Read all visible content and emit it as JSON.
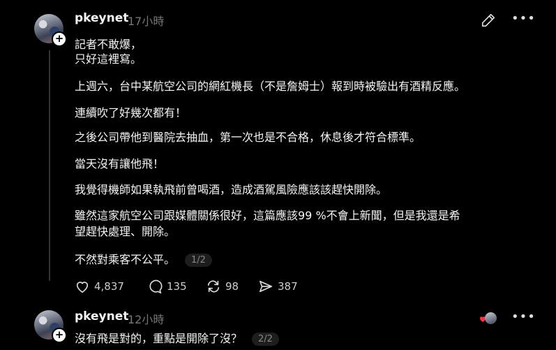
{
  "post1": {
    "username": "pkeynet",
    "time": "17小時",
    "lines": [
      "記者不敢爆，",
      "只好這裡寫。",
      "上週六，台中某航空公司的網紅機長（不是詹姆士）報到時被驗出有酒精反應。",
      "連續吹了好幾次都有！",
      "之後公司帶他到醫院去抽血，第一次也是不合格，休息後才符合標準。",
      "當天沒有讓他飛！",
      "我覺得機師如果執飛前曾喝酒，造成酒駕風險應該該趕快開除。",
      "￼雖然這家航空公司跟媒體關係很好，這篇應該99 %不會上新聞，但是我還是希",
      "望趕快處理、開除。",
      "￼不然對乘客不公平。"
    ],
    "page": "1/2",
    "likes": "4,837",
    "comments": "135",
    "reposts": "98",
    "shares": "387"
  },
  "post2": {
    "username": "pkeynet",
    "time": "12小時",
    "text": "沒有飛是對的，重點是開除了沒？",
    "page": "2/2"
  },
  "icons": {
    "edit": "pencil-icon",
    "more": "more-dots-icon",
    "like": "heart-icon",
    "comment": "comment-icon",
    "repost": "repost-icon",
    "share": "share-icon"
  },
  "colors": {
    "background": "#000000",
    "text": "#f3f5f7",
    "muted": "#777777",
    "heart": "#ff3040"
  }
}
